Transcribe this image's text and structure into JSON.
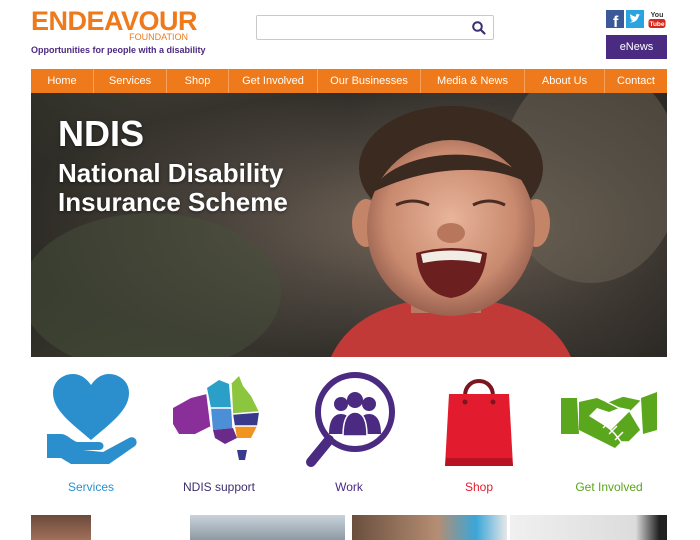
{
  "header": {
    "logo_main": "ENDEAVOUR",
    "logo_sub": "FOUNDATION",
    "tagline": "Opportunities for people with a disability",
    "search_placeholder": "",
    "enews_label": "eNews",
    "youtube_label_top": "You",
    "youtube_label_bottom": "Tube"
  },
  "nav": {
    "items": [
      {
        "label": "Home"
      },
      {
        "label": "Services"
      },
      {
        "label": "Shop"
      },
      {
        "label": "Get Involved"
      },
      {
        "label": "Our Businesses"
      },
      {
        "label": "Media & News"
      },
      {
        "label": "About Us"
      },
      {
        "label": "Contact"
      }
    ]
  },
  "hero": {
    "title": "NDIS",
    "subtitle_line1": "National Disability",
    "subtitle_line2": "Insurance Scheme"
  },
  "tiles": [
    {
      "label": "Services",
      "icon": "heart-hand-icon",
      "color": "#2b8fce"
    },
    {
      "label": "NDIS support",
      "icon": "australia-map-icon",
      "color": "#3d2f6e"
    },
    {
      "label": "Work",
      "icon": "people-magnifier-icon",
      "color": "#4b2a82"
    },
    {
      "label": "Shop",
      "icon": "shopping-bag-icon",
      "color": "#e21b2e"
    },
    {
      "label": "Get Involved",
      "icon": "handshake-icon",
      "color": "#5aa61c"
    }
  ],
  "colors": {
    "brand_orange": "#ee7a1b",
    "brand_purple": "#4b2a82"
  }
}
